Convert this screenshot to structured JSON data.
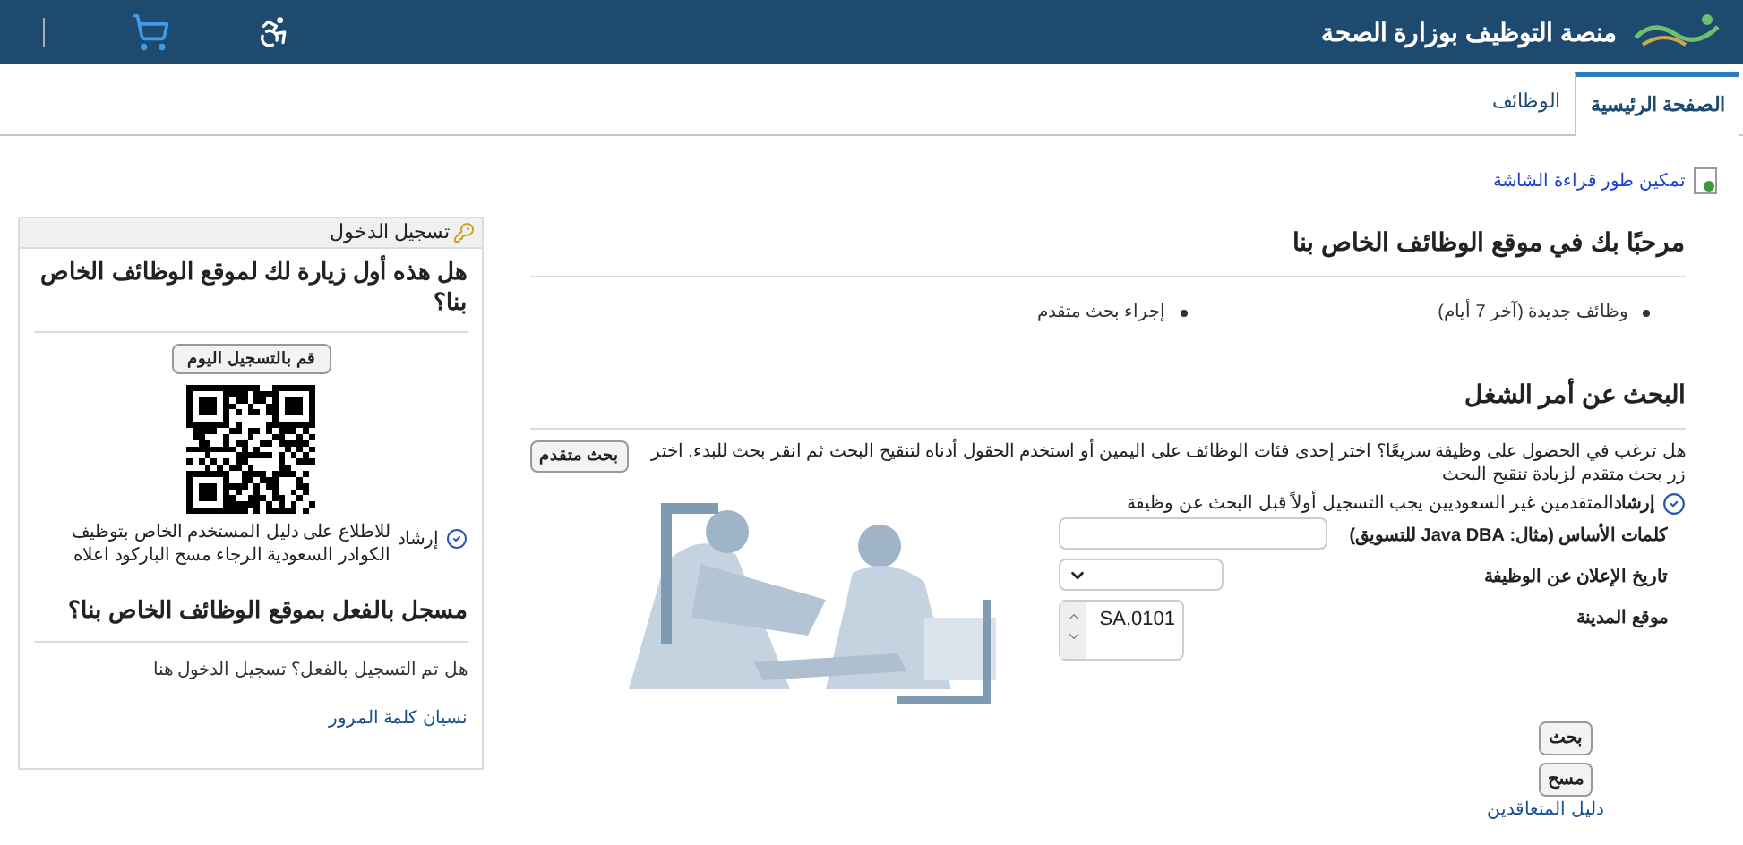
{
  "header": {
    "title": "منصة التوظيف بوزارة الصحة"
  },
  "tabs": [
    {
      "label": "الصفحة الرئيسية",
      "selected": true
    },
    {
      "label": "الوظائف",
      "selected": false
    }
  ],
  "screen_reader_link": "تمكين طور قراءة الشاشة",
  "welcome": {
    "title": "مرحبًا بك في موقع الوظائف الخاص بنا",
    "links": [
      "وظائف جديدة (آخر 7 أيام)",
      "إجراء بحث متقدم"
    ]
  },
  "search": {
    "title": "البحث عن أمر الشغل",
    "description": "هل ترغب في الحصول على وظيفة سريعًا؟ اختر إحدى فئات الوظائف على اليمين أو استخدم الحقول أدناه لتنقيح البحث ثم انقر بحث للبدء. اختر زر بحث متقدم لزيادة تنقيح البحث",
    "advanced_button": "بحث متقدم",
    "notice": "**إرشاد**المتقدمين غير السعوديين يجب التسجيل أولاً قبل البحث عن وظيفة",
    "fields": [
      {
        "kind": "text",
        "label": "كلمات الأساس (مثال: Java DBA للتسويق)"
      },
      {
        "kind": "select",
        "label": "تاريخ الإعلان عن الوظيفة"
      },
      {
        "kind": "list",
        "label": "موقع المدينة",
        "value": "SA,0101"
      }
    ],
    "buttons": [
      "بحث",
      "مسح"
    ],
    "guide_link": "دليل المتعاقدين"
  },
  "login": {
    "title": "تسجيل الدخول",
    "first_visit_heading": "هل هذه أول زيارة لك لموقع الوظائف الخاص بنا؟",
    "register_button": "قم بالتسجيل اليوم",
    "guide_label": "إرشاد",
    "guide_text": "للاطلاع على دليل المستخدم الخاص بتوظيف الكوادر السعودية الرجاء مسح الباركود اعلاه",
    "registered_heading": "مسجل بالفعل بموقع الوظائف الخاص بنا؟",
    "login_link": "هل تم التسجيل بالفعل؟ تسجيل الدخول هنا",
    "forgot_link": "نسيان كلمة المرور"
  }
}
